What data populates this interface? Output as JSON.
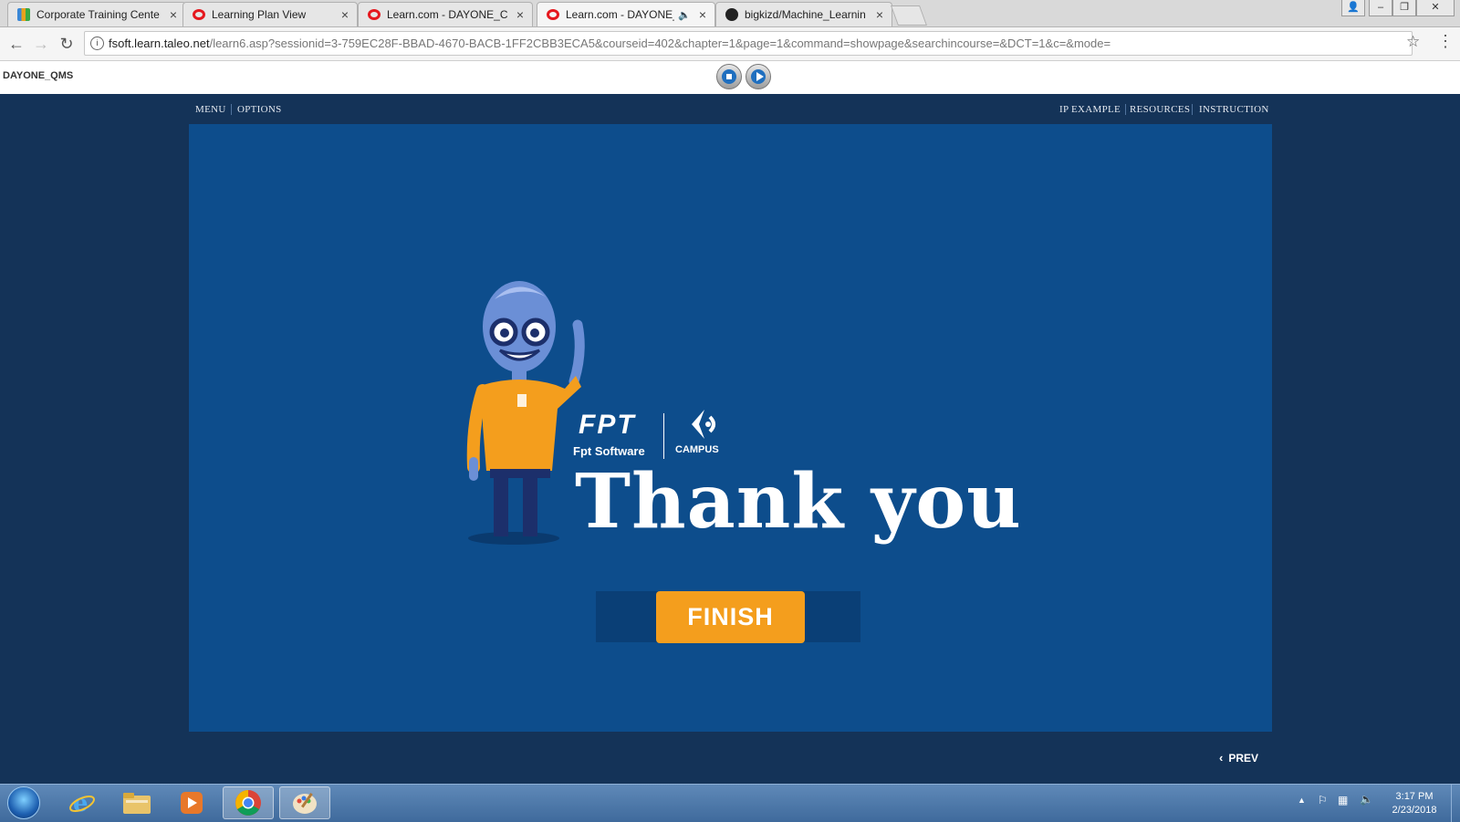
{
  "browser": {
    "tabs": [
      {
        "title": "Corporate Training Cente",
        "favicon": "grid-favicon"
      },
      {
        "title": "Learning Plan View",
        "favicon": "oracle-favicon"
      },
      {
        "title": "Learn.com - DAYONE_Co",
        "favicon": "oracle-favicon"
      },
      {
        "title": "Learn.com - DAYONE_",
        "favicon": "oracle-favicon",
        "active": true,
        "audio": true
      },
      {
        "title": "bigkizd/Machine_Learnin",
        "favicon": "github-favicon"
      }
    ],
    "url_host": "fsoft.learn.taleo.net",
    "url_path": "/learn6.asp?sessionid=3-759EC28F-BBAD-4670-BACB-1FF2CBB3ECA5&courseid=402&chapter=1&page=1&command=showpage&searchincourse=&DCT=1&c=&mode="
  },
  "page_header": {
    "app_name": "DAYONE_QMS"
  },
  "course_nav": {
    "menu": "MENU",
    "options": "OPTIONS",
    "ip_example": "IP EXAMPLE",
    "resources": "RESOURCES",
    "instruction": "INSTRUCTION"
  },
  "slide": {
    "logo_fpt": "FPT",
    "logo_subtitle": "Fpt Software",
    "logo_campus": "CAMPUS",
    "headline": "Thank you",
    "finish_label": "FINISH",
    "prev_label": "PREV"
  },
  "colors": {
    "slide_bg": "#0d4d8c",
    "frame_bg": "#143358",
    "finish_orange": "#f49e1d",
    "character_shirt": "#f49e1d"
  },
  "taskbar": {
    "clock_time": "3:17 PM",
    "clock_date": "2/23/2018",
    "pinned": [
      "start-orb",
      "internet-explorer-icon",
      "file-explorer-icon",
      "media-player-icon",
      "chrome-icon",
      "paint-icon"
    ]
  }
}
